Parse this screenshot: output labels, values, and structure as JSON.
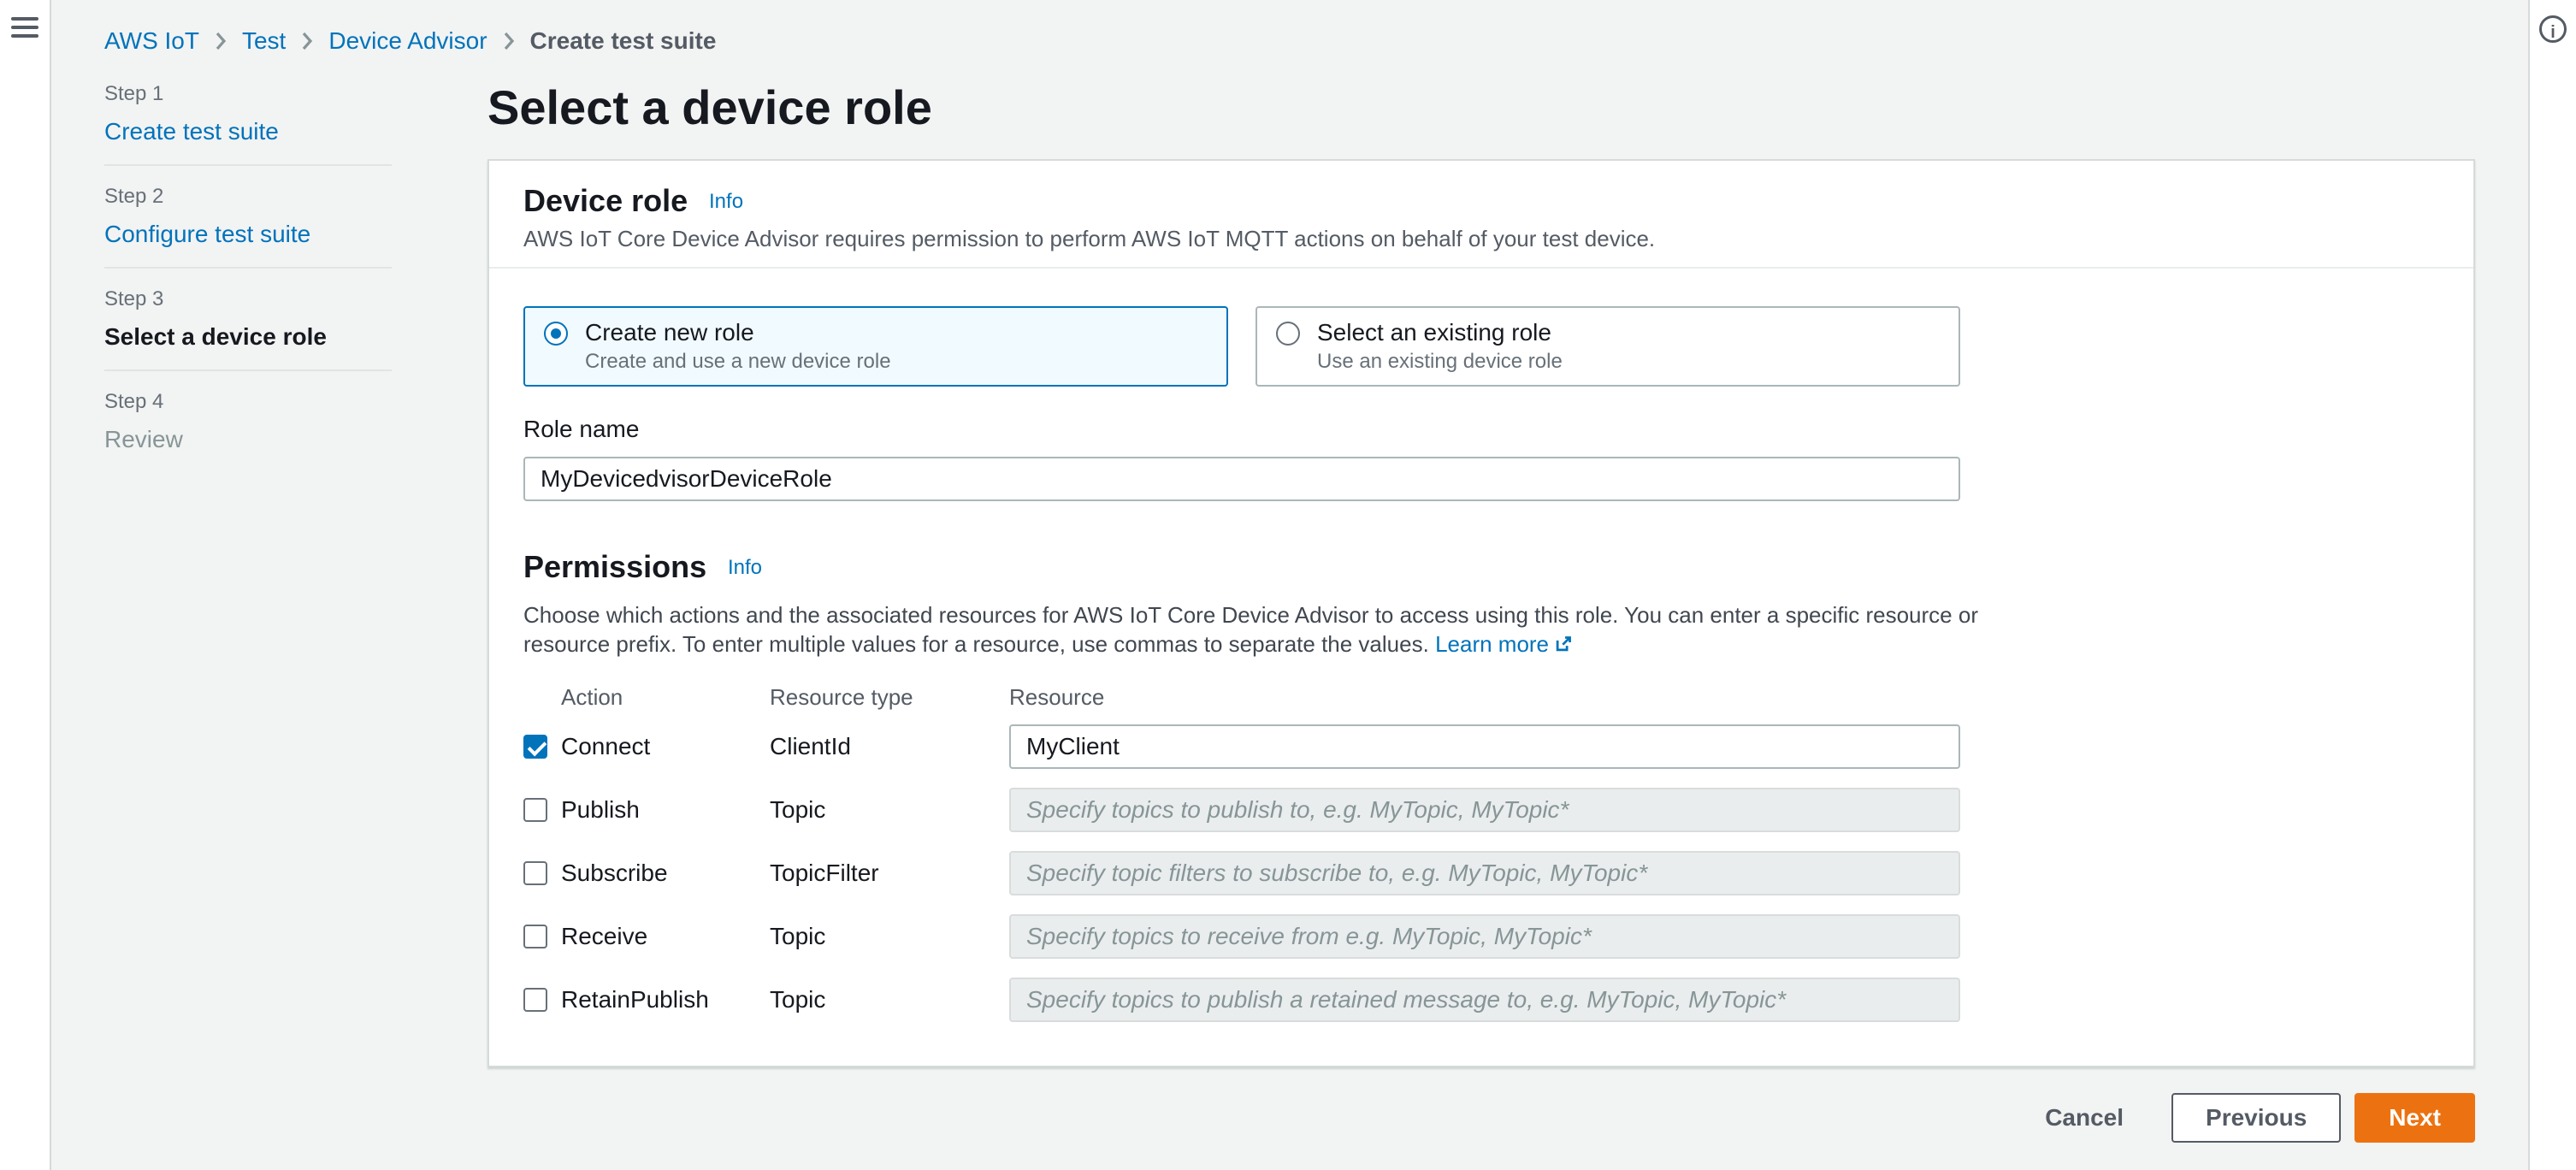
{
  "colors": {
    "accent_link": "#0073bb",
    "primary_button": "#ec7211",
    "selected_tile_bg": "#f1faff",
    "selected_tile_border": "#0073bb",
    "page_background": "#f2f3f3"
  },
  "icons": {
    "menu": "hamburger",
    "help_glyph": "i",
    "breadcrumb_separator": "chevron-right",
    "external_link": "arrow-out-of-box"
  },
  "breadcrumbs": {
    "items": [
      {
        "label": "AWS IoT",
        "current": false
      },
      {
        "label": "Test",
        "current": false
      },
      {
        "label": "Device Advisor",
        "current": false
      },
      {
        "label": "Create test suite",
        "current": true
      }
    ]
  },
  "wizard_nav": {
    "steps": [
      {
        "step_label": "Step 1",
        "title": "Create test suite",
        "state": "link"
      },
      {
        "step_label": "Step 2",
        "title": "Configure test suite",
        "state": "link"
      },
      {
        "step_label": "Step 3",
        "title": "Select a device role",
        "state": "current"
      },
      {
        "step_label": "Step 4",
        "title": "Review",
        "state": "disabled"
      }
    ]
  },
  "page": {
    "title": "Select a device role"
  },
  "device_role": {
    "title": "Device role",
    "info_label": "Info",
    "description": "AWS IoT Core Device Advisor requires permission to perform AWS IoT MQTT actions on behalf of your test device.",
    "options": [
      {
        "label": "Create new role",
        "description": "Create and use a new device role",
        "selected": true
      },
      {
        "label": "Select an existing role",
        "description": "Use an existing device role",
        "selected": false
      }
    ],
    "role_name": {
      "label": "Role name",
      "value": "MyDevicedvisorDeviceRole"
    }
  },
  "permissions": {
    "title": "Permissions",
    "info_label": "Info",
    "description": "Choose which actions and the associated resources for AWS IoT Core Device Advisor to access using this role. You can enter a specific resource or resource prefix. To enter multiple values for a resource, use commas to separate the values.",
    "learn_more_label": "Learn more",
    "table": {
      "headers": [
        "Action",
        "Resource type",
        "Resource"
      ],
      "rows": [
        {
          "action": "Connect",
          "checked": true,
          "resource_type": "ClientId",
          "value": "MyClient",
          "placeholder": "",
          "enabled": true
        },
        {
          "action": "Publish",
          "checked": false,
          "resource_type": "Topic",
          "value": "",
          "placeholder": "Specify topics to publish to, e.g. MyTopic, MyTopic*",
          "enabled": false
        },
        {
          "action": "Subscribe",
          "checked": false,
          "resource_type": "TopicFilter",
          "value": "",
          "placeholder": "Specify topic filters to subscribe to, e.g. MyTopic, MyTopic*",
          "enabled": false
        },
        {
          "action": "Receive",
          "checked": false,
          "resource_type": "Topic",
          "value": "",
          "placeholder": "Specify topics to receive from e.g. MyTopic, MyTopic*",
          "enabled": false
        },
        {
          "action": "RetainPublish",
          "checked": false,
          "resource_type": "Topic",
          "value": "",
          "placeholder": "Specify topics to publish a retained message to, e.g. MyTopic, MyTopic*",
          "enabled": false
        }
      ]
    }
  },
  "footer": {
    "cancel_label": "Cancel",
    "previous_label": "Previous",
    "next_label": "Next"
  }
}
